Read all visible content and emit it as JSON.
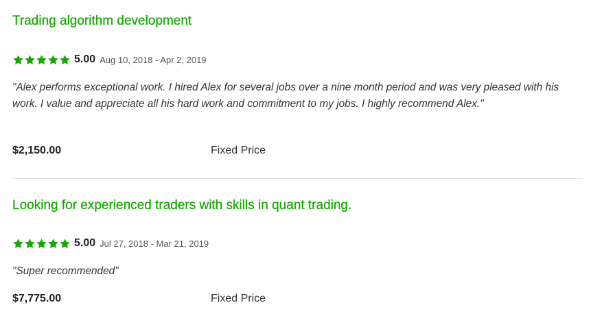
{
  "colors": {
    "accent": "#14a800",
    "divider": "#e4e4e4"
  },
  "reviews": [
    {
      "title": "Trading algorithm development",
      "stars_filled": 5,
      "stars_total": 5,
      "star_icon": "star-icon",
      "score": "5.00",
      "dates": "Aug 10, 2018 - Apr 2, 2019",
      "quote": "\"Alex performs exceptional work. I hired Alex for several jobs over a nine month period and was very pleased with his work. I value and appreciate all his hard work and commitment to my jobs. I highly recommend Alex.\"",
      "amount": "$2,150.00",
      "price_type": "Fixed Price"
    },
    {
      "title": "Looking for experienced traders with skills in quant trading.",
      "stars_filled": 5,
      "stars_total": 5,
      "star_icon": "star-icon",
      "score": "5.00",
      "dates": "Jul 27, 2018 - Mar 21, 2019",
      "quote": "\"Super recommended\"",
      "amount": "$7,775.00",
      "price_type": "Fixed Price"
    }
  ]
}
